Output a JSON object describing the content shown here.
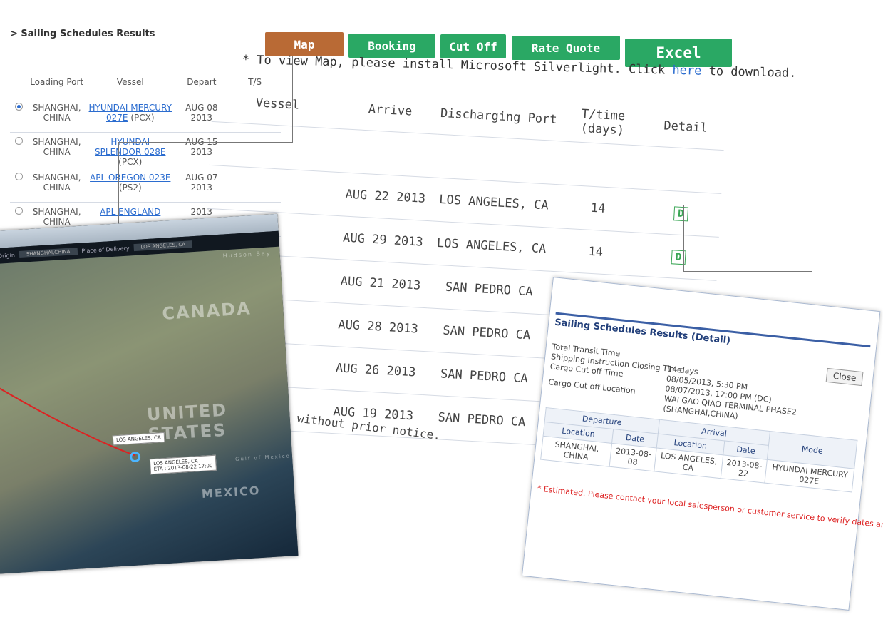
{
  "page": {
    "title": "> Sailing Schedules Results"
  },
  "toolbar": {
    "map": "Map",
    "booking": "Booking",
    "cutoff": "Cut Off",
    "rate": "Rate Quote",
    "excel": "Excel"
  },
  "note": {
    "before": "* To view Map, please install Microsoft Silverlight. Click ",
    "link": "here",
    "after": " to download."
  },
  "left_table": {
    "headers": [
      "Loading Port",
      "Vessel",
      "Depart",
      "T/S"
    ],
    "rows": [
      {
        "port": "SHANGHAI, CHINA",
        "vessel": "HYUNDAI MERCURY 027E",
        "svc": "(PCX)",
        "depart": "AUG 08 2013",
        "selected": true
      },
      {
        "port": "SHANGHAI, CHINA",
        "vessel": "HYUNDAI SPLENDOR 028E",
        "svc": "(PCX)",
        "depart": "AUG 15 2013",
        "selected": false
      },
      {
        "port": "SHANGHAI, CHINA",
        "vessel": "APL OREGON 023E",
        "svc": "(PS2)",
        "depart": "AUG 07 2013",
        "selected": false
      },
      {
        "port": "SHANGHAI, CHINA",
        "vessel": "APL ENGLAND",
        "svc": "",
        "depart": "2013",
        "selected": false
      }
    ]
  },
  "right_table": {
    "headers": [
      "Vessel",
      "Arrive",
      "Discharging Port",
      "T/time (days)",
      "Detail"
    ],
    "rows": [
      {
        "arrive": "",
        "port": "",
        "ttime": "",
        "detail": ""
      },
      {
        "arrive": "AUG 22 2013",
        "port": "LOS ANGELES, CA",
        "ttime": "14",
        "detail": "D"
      },
      {
        "arrive": "AUG 29 2013",
        "port": "LOS ANGELES, CA",
        "ttime": "14",
        "detail": "D"
      },
      {
        "arrive": "AUG 21 2013",
        "port": "SAN PEDRO CA",
        "ttime": "",
        "detail": ""
      },
      {
        "arrive": "AUG 28 2013",
        "port": "SAN PEDRO CA",
        "ttime": "",
        "detail": ""
      },
      {
        "arrive": "AUG 26 2013",
        "port": "SAN PEDRO CA",
        "ttime": "",
        "detail": ""
      },
      {
        "arrive": "AUG 19 2013",
        "port": "SAN PEDRO CA",
        "ttime": "",
        "detail": ""
      }
    ]
  },
  "disclaimer": "nge without prior notice.",
  "map_window": {
    "origin_label": "Port of Origin",
    "origin_value": "SHANGHAI,CHINA",
    "delivery_label": "Place of Delivery",
    "delivery_value": "LOS ANGELES, CA",
    "labels": {
      "hudson": "Hudson Bay",
      "canada": "CANADA",
      "us": "UNITED STATES",
      "mexico": "MEXICO",
      "gulf": "Gulf of Mexico"
    },
    "tip1": "LOS ANGELES, CA",
    "tip2": "LOS ANGELES, CA",
    "tip2_eta": "ETA : 2013-08-22 17:00"
  },
  "detail": {
    "title": "Sailing Schedules Results (Detail)",
    "close": "Close",
    "labels": [
      "Total Transit Time",
      "Shipping Instruction Closing Time",
      "Cargo Cut off Time",
      "Cargo Cut off Location"
    ],
    "values": [
      "14 days",
      "08/05/2013, 5:30 PM",
      "08/07/2013, 12:00 PM (DC)",
      "WAI GAO QIAO TERMINAL PHASE2 (SHANGHAI,CHINA)"
    ],
    "departure": "Departure",
    "arrival": "Arrival",
    "col_location": "Location",
    "col_date": "Date",
    "col_mode": "Mode",
    "dep_location": "SHANGHAI, CHINA",
    "dep_date": "2013-08-08",
    "arr_location": "LOS ANGELES, CA",
    "arr_date": "2013-08-22",
    "mode": "HYUNDAI MERCURY 027E",
    "warning": "* Estimated. Please contact your local salesperson or customer service to verify dates and times."
  },
  "colors": {
    "map_btn": "#b96a35",
    "action_btn": "#2aa864",
    "link": "#2b6ccf",
    "warning": "#dd2222"
  }
}
